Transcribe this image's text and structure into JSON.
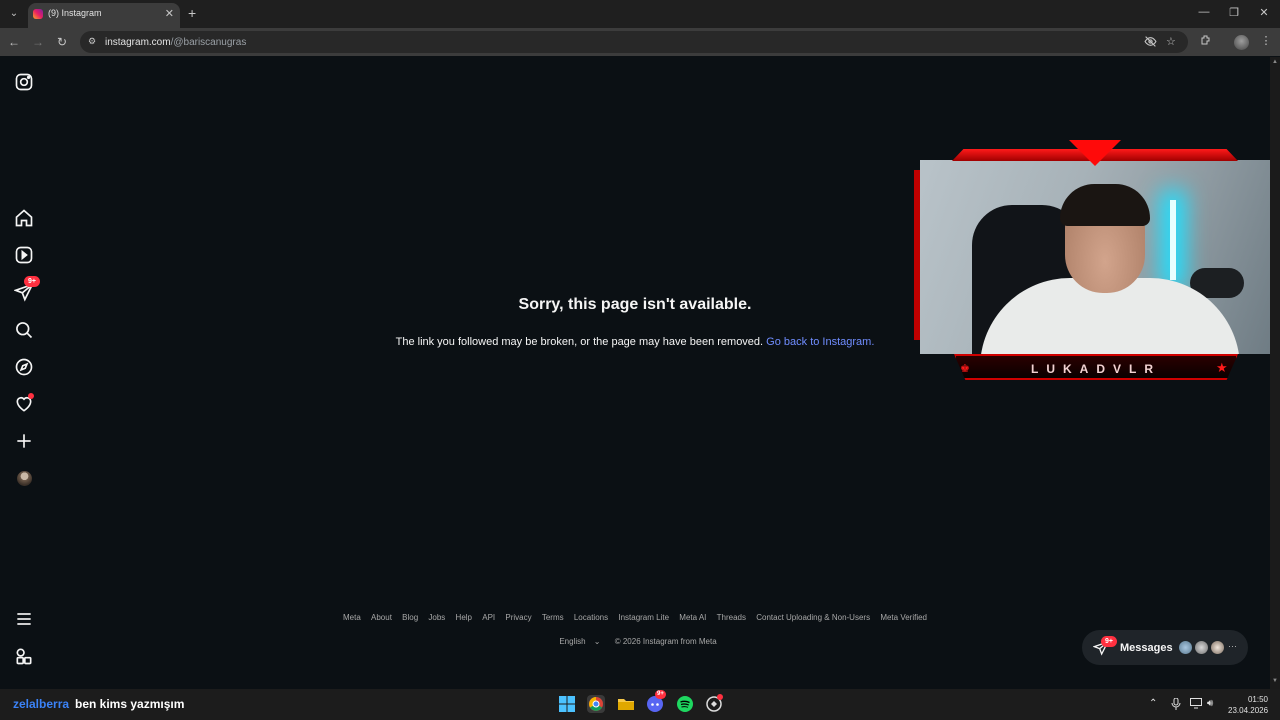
{
  "browser": {
    "tab_title": "(9) Instagram",
    "url_host": "instagram.com",
    "url_path": "/@bariscanugras"
  },
  "sidebar": {
    "notifications_badge": "9+"
  },
  "error": {
    "title": "Sorry, this page isn't available.",
    "text": "The link you followed may be broken, or the page may have been removed.",
    "link": "Go back to Instagram."
  },
  "footer": {
    "links": [
      "Meta",
      "About",
      "Blog",
      "Jobs",
      "Help",
      "API",
      "Privacy",
      "Terms",
      "Locations",
      "Instagram Lite",
      "Meta AI",
      "Threads",
      "Contact Uploading & Non-Users",
      "Meta Verified"
    ],
    "language": "English",
    "copyright": "© 2026 Instagram from Meta"
  },
  "messages": {
    "label": "Messages",
    "badge": "9+"
  },
  "overlay": {
    "name": "LUKADVLR"
  },
  "taskbar": {
    "chat_user": "zelalberra",
    "chat_message": "ben kims yazmışım",
    "discord_badge": "9+",
    "time": "01:50",
    "date": "23.04.2026"
  },
  "colors": {
    "page_bg": "#0b1014",
    "link": "#708dff",
    "badge": "#ff3040",
    "overlay_red": "#ff1a1a"
  }
}
